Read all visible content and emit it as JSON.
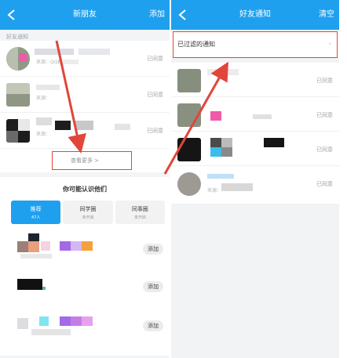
{
  "left": {
    "header": {
      "title": "新朋友",
      "action": "添加"
    },
    "section_label": "好友通知",
    "notices": [
      {
        "meta": "来源：QQ群",
        "status": "已同意"
      },
      {
        "meta": "来源：",
        "status": "已同意"
      },
      {
        "meta": "来源：",
        "status": "已同意"
      }
    ],
    "more_label": "查看更多 >",
    "people_heading": "你可能认识他们",
    "tabs": [
      {
        "label": "推荐",
        "sub": "47人"
      },
      {
        "label": "同学圈",
        "sub": "未开启"
      },
      {
        "label": "同事圈",
        "sub": "未开启"
      }
    ],
    "add_label": "添加"
  },
  "right": {
    "header": {
      "title": "好友通知",
      "action": "清空"
    },
    "filter_label": "已过滤的通知",
    "filter_chevron": "›",
    "notices": [
      {
        "meta": "",
        "status": "已同意"
      },
      {
        "meta": "",
        "status": "已同意"
      },
      {
        "meta": "",
        "status": "已同意"
      },
      {
        "meta": "来源：",
        "status": "已同意"
      }
    ]
  },
  "colors": {
    "accent": "#1fa0ef",
    "highlight": "#e0463a"
  }
}
